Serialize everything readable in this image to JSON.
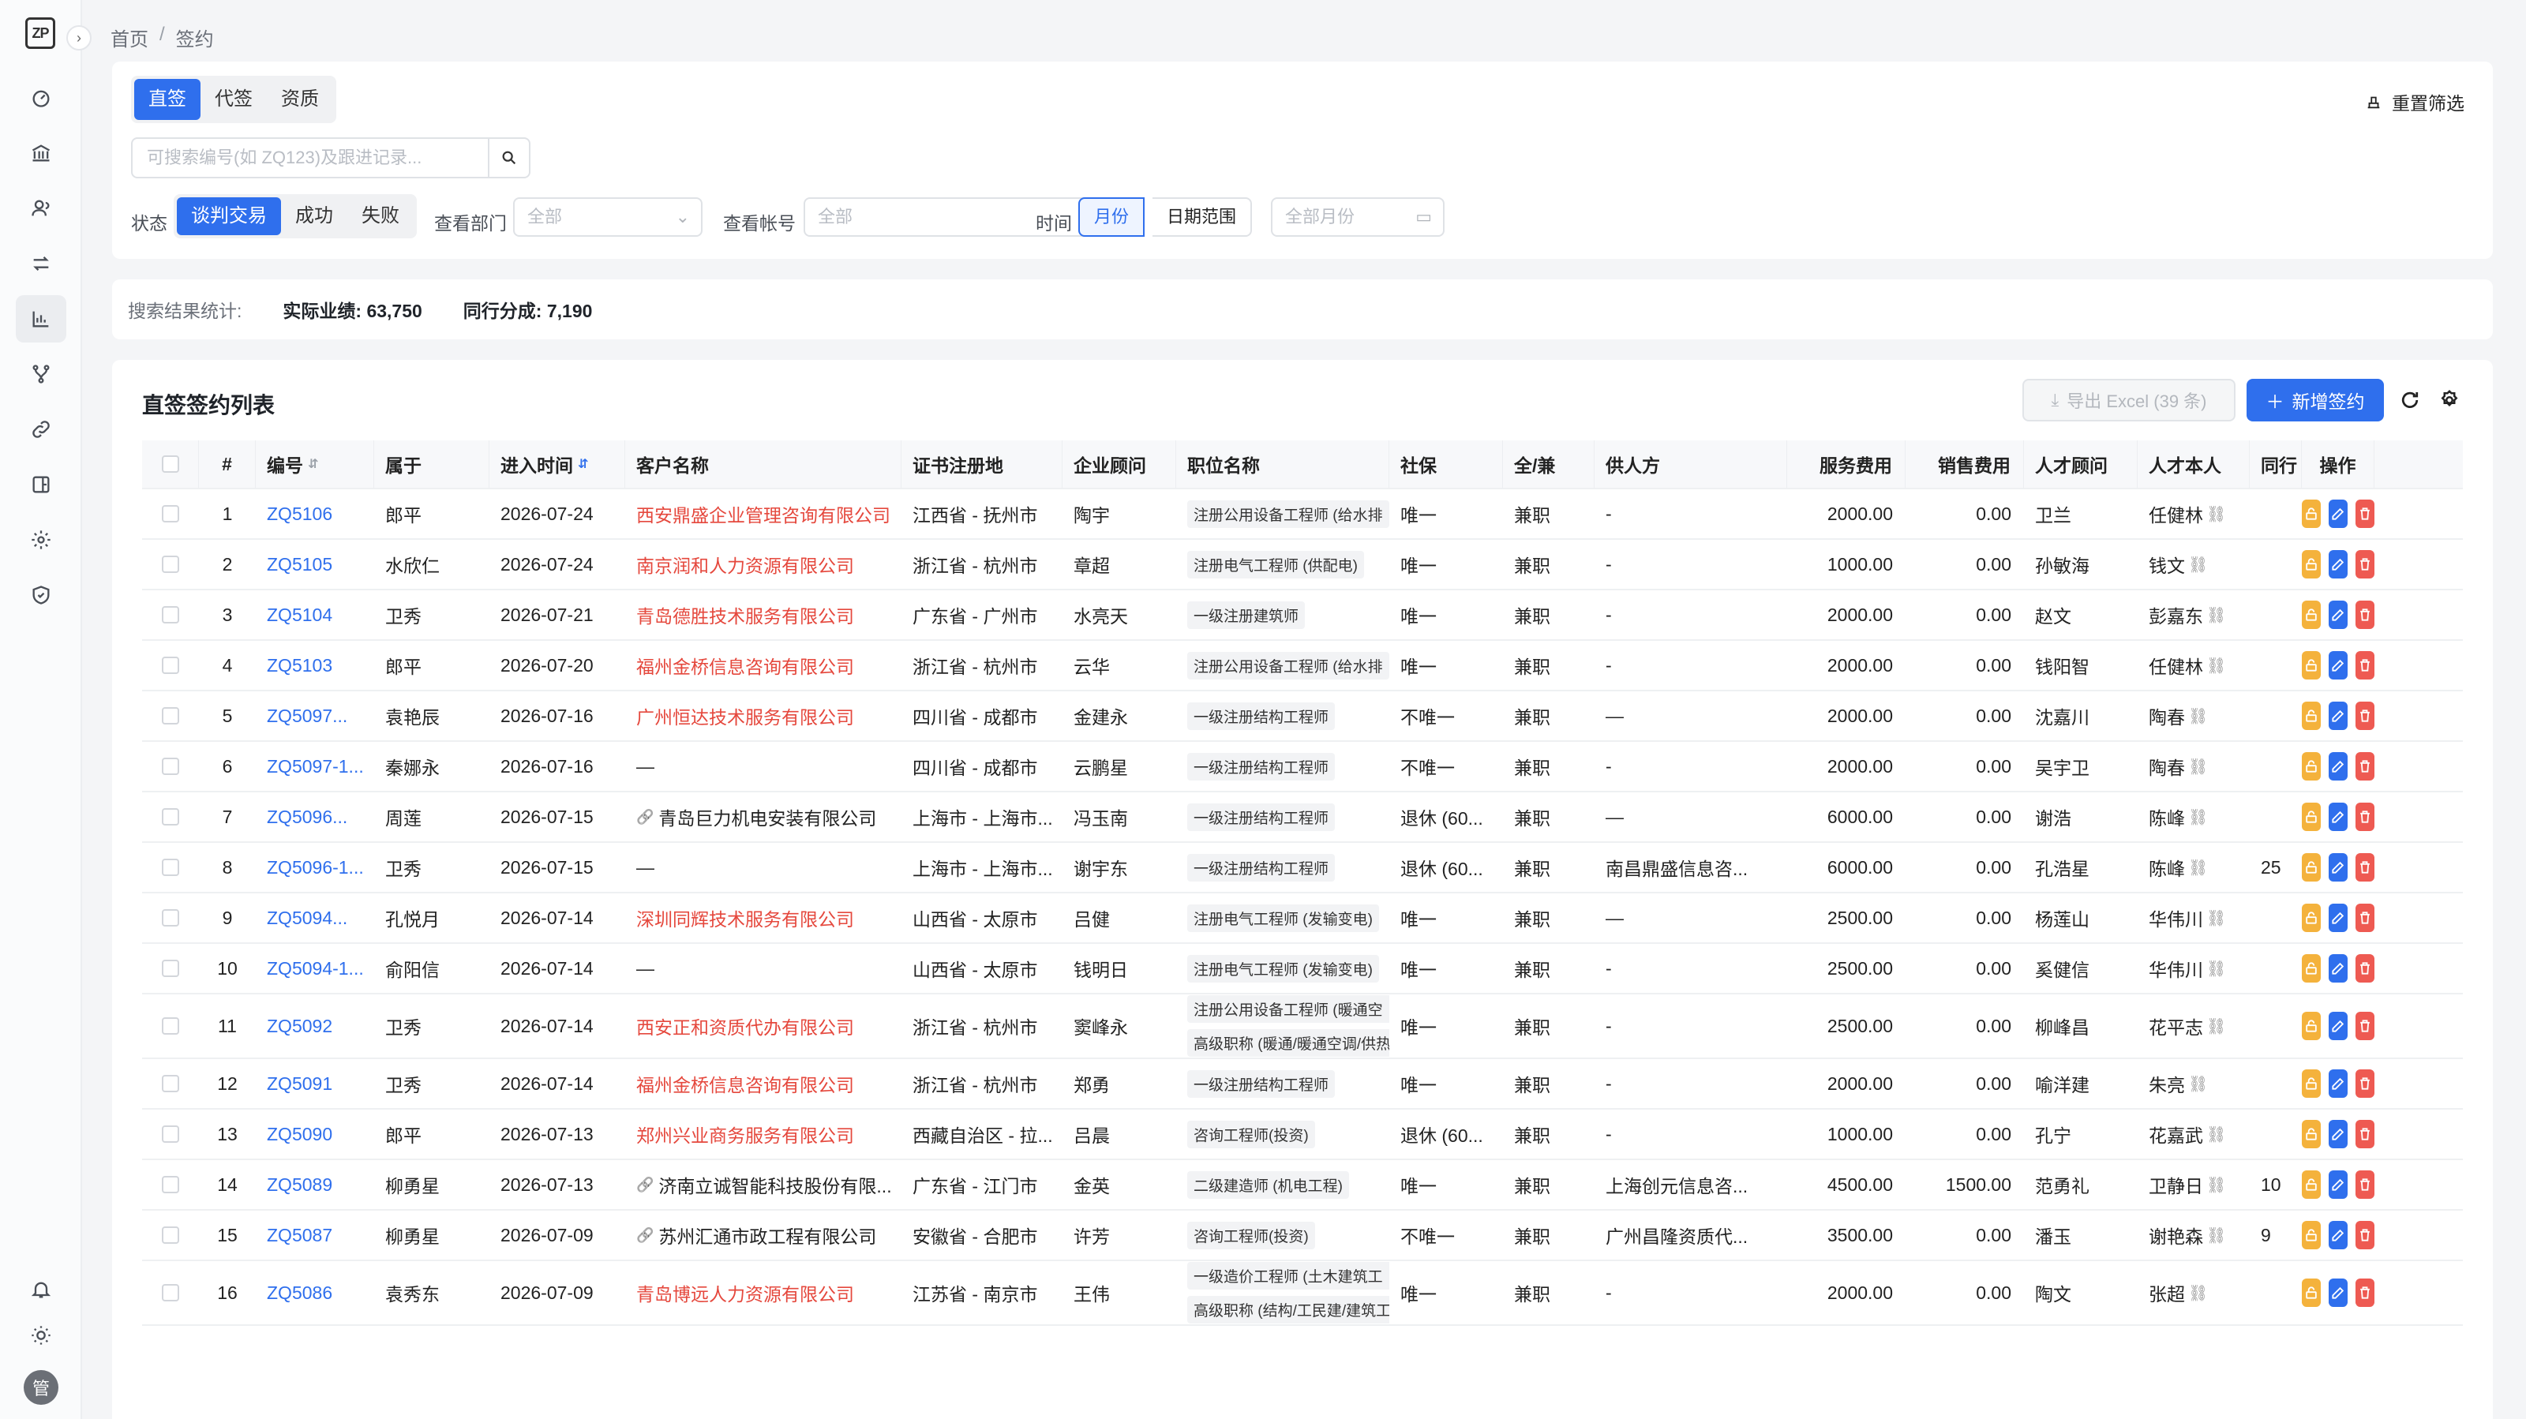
{
  "app": {
    "logo_text": "ZP"
  },
  "breadcrumb": {
    "home": "首页",
    "sep": "/",
    "current": "签约"
  },
  "tabs": [
    {
      "label": "直签",
      "active": true
    },
    {
      "label": "代签"
    },
    {
      "label": "资质"
    }
  ],
  "reset_label": "重置筛选",
  "search": {
    "placeholder": "可搜索编号(如 ZQ123)及跟进记录..."
  },
  "filters": {
    "status_label": "状态",
    "status_opts": [
      "谈判交易",
      "成功",
      "失败"
    ],
    "dept_label": "查看部门",
    "dept_value": "全部",
    "account_label": "查看帐号",
    "account_value": "全部",
    "time_label": "时间",
    "time_month": "月份",
    "time_range": "日期范围",
    "month_value": "全部月份"
  },
  "stats": {
    "label": "搜索结果统计:",
    "actual": "实际业绩: 63,750",
    "peer": "同行分成: 7,190"
  },
  "table": {
    "title": "直签签约列表",
    "export_label": "导出 Excel (39 条)",
    "add_label": "新增签约",
    "columns": [
      "#",
      "编号",
      "属于",
      "进入时间",
      "客户名称",
      "证书注册地",
      "企业顾问",
      "职位名称",
      "社保",
      "全/兼",
      "供人方",
      "服务费用",
      "销售费用",
      "人才顾问",
      "人才本人",
      "同行",
      "操作"
    ],
    "rows": [
      {
        "n": "1",
        "id": "ZQ5106",
        "owner": "郎平",
        "date": "2026-07-24",
        "client": "西安鼎盛企业管理咨询有限公司",
        "client_style": "red",
        "reg": "江西省 - 抚州市",
        "adv": "陶宇",
        "pos": [
          "注册公用设备工程师 (给水排"
        ],
        "ss": "唯一",
        "type": "兼职",
        "supplier": "-",
        "fee": "2000.00",
        "sales": "0.00",
        "tadv": "卫兰",
        "talent": "任健林",
        "peer": ""
      },
      {
        "n": "2",
        "id": "ZQ5105",
        "owner": "水欣仁",
        "date": "2026-07-24",
        "client": "南京润和人力资源有限公司",
        "client_style": "red",
        "reg": "浙江省 - 杭州市",
        "adv": "章超",
        "pos": [
          "注册电气工程师 (供配电)"
        ],
        "ss": "唯一",
        "type": "兼职",
        "supplier": "-",
        "fee": "1000.00",
        "sales": "0.00",
        "tadv": "孙敏海",
        "talent": "钱文",
        "peer": ""
      },
      {
        "n": "3",
        "id": "ZQ5104",
        "owner": "卫秀",
        "date": "2026-07-21",
        "client": "青岛德胜技术服务有限公司",
        "client_style": "red",
        "reg": "广东省 - 广州市",
        "adv": "水亮天",
        "pos": [
          "一级注册建筑师"
        ],
        "ss": "唯一",
        "type": "兼职",
        "supplier": "-",
        "fee": "2000.00",
        "sales": "0.00",
        "tadv": "赵文",
        "talent": "彭嘉东",
        "peer": ""
      },
      {
        "n": "4",
        "id": "ZQ5103",
        "owner": "郎平",
        "date": "2026-07-20",
        "client": "福州金桥信息咨询有限公司",
        "client_style": "red",
        "reg": "浙江省 - 杭州市",
        "adv": "云华",
        "pos": [
          "注册公用设备工程师 (给水排"
        ],
        "ss": "唯一",
        "type": "兼职",
        "supplier": "-",
        "fee": "2000.00",
        "sales": "0.00",
        "tadv": "钱阳智",
        "talent": "任健林",
        "peer": ""
      },
      {
        "n": "5",
        "id": "ZQ5097...",
        "owner": "袁艳辰",
        "date": "2026-07-16",
        "client": "广州恒达技术服务有限公司",
        "client_style": "red",
        "reg": "四川省 - 成都市",
        "adv": "金建永",
        "pos": [
          "一级注册结构工程师"
        ],
        "ss": "不唯一",
        "type": "兼职",
        "supplier": "—",
        "fee": "2000.00",
        "sales": "0.00",
        "tadv": "沈嘉川",
        "talent": "陶春",
        "peer": ""
      },
      {
        "n": "6",
        "id": "ZQ5097-1...",
        "owner": "秦娜永",
        "date": "2026-07-16",
        "client": "—",
        "client_style": "plain",
        "reg": "四川省 - 成都市",
        "adv": "云鹏星",
        "pos": [
          "一级注册结构工程师"
        ],
        "ss": "不唯一",
        "type": "兼职",
        "supplier": "-",
        "fee": "2000.00",
        "sales": "0.00",
        "tadv": "吴宇卫",
        "talent": "陶春",
        "peer": ""
      },
      {
        "n": "7",
        "id": "ZQ5096...",
        "owner": "周莲",
        "date": "2026-07-15",
        "client": "青岛巨力机电安装有限公司",
        "client_style": "chain",
        "reg": "上海市 - 上海市...",
        "adv": "冯玉南",
        "pos": [
          "一级注册结构工程师"
        ],
        "ss": "退休 (60...",
        "type": "兼职",
        "supplier": "—",
        "fee": "6000.00",
        "sales": "0.00",
        "tadv": "谢浩",
        "talent": "陈峰",
        "peer": ""
      },
      {
        "n": "8",
        "id": "ZQ5096-1...",
        "owner": "卫秀",
        "date": "2026-07-15",
        "client": "—",
        "client_style": "plain",
        "reg": "上海市 - 上海市...",
        "adv": "谢宇东",
        "pos": [
          "一级注册结构工程师"
        ],
        "ss": "退休 (60...",
        "type": "兼职",
        "supplier": "南昌鼎盛信息咨...",
        "fee": "6000.00",
        "sales": "0.00",
        "tadv": "孔浩星",
        "talent": "陈峰",
        "peer": "25"
      },
      {
        "n": "9",
        "id": "ZQ5094...",
        "owner": "孔悦月",
        "date": "2026-07-14",
        "client": "深圳同辉技术服务有限公司",
        "client_style": "red",
        "reg": "山西省 - 太原市",
        "adv": "吕健",
        "pos": [
          "注册电气工程师 (发输变电)"
        ],
        "ss": "唯一",
        "type": "兼职",
        "supplier": "—",
        "fee": "2500.00",
        "sales": "0.00",
        "tadv": "杨莲山",
        "talent": "华伟川",
        "peer": ""
      },
      {
        "n": "10",
        "id": "ZQ5094-1...",
        "owner": "俞阳信",
        "date": "2026-07-14",
        "client": "—",
        "client_style": "plain",
        "reg": "山西省 - 太原市",
        "adv": "钱明日",
        "pos": [
          "注册电气工程师 (发输变电)"
        ],
        "ss": "唯一",
        "type": "兼职",
        "supplier": "-",
        "fee": "2500.00",
        "sales": "0.00",
        "tadv": "奚健信",
        "talent": "华伟川",
        "peer": ""
      },
      {
        "n": "11",
        "id": "ZQ5092",
        "owner": "卫秀",
        "date": "2026-07-14",
        "client": "西安正和资质代办有限公司",
        "client_style": "red",
        "reg": "浙江省 - 杭州市",
        "adv": "窦峰永",
        "pos": [
          "注册公用设备工程师 (暖通空",
          "高级职称 (暖通/暖通空调/供热"
        ],
        "ss": "唯一",
        "type": "兼职",
        "supplier": "-",
        "fee": "2500.00",
        "sales": "0.00",
        "tadv": "柳峰昌",
        "talent": "花平志",
        "peer": ""
      },
      {
        "n": "12",
        "id": "ZQ5091",
        "owner": "卫秀",
        "date": "2026-07-14",
        "client": "福州金桥信息咨询有限公司",
        "client_style": "red",
        "reg": "浙江省 - 杭州市",
        "adv": "郑勇",
        "pos": [
          "一级注册结构工程师"
        ],
        "ss": "唯一",
        "type": "兼职",
        "supplier": "-",
        "fee": "2000.00",
        "sales": "0.00",
        "tadv": "喻洋建",
        "talent": "朱亮",
        "peer": ""
      },
      {
        "n": "13",
        "id": "ZQ5090",
        "owner": "郎平",
        "date": "2026-07-13",
        "client": "郑州兴业商务服务有限公司",
        "client_style": "red",
        "reg": "西藏自治区 - 拉...",
        "adv": "吕晨",
        "pos": [
          "咨询工程师(投资)"
        ],
        "ss": "退休 (60...",
        "type": "兼职",
        "supplier": "-",
        "fee": "1000.00",
        "sales": "0.00",
        "tadv": "孔宁",
        "talent": "花嘉武",
        "peer": ""
      },
      {
        "n": "14",
        "id": "ZQ5089",
        "owner": "柳勇星",
        "date": "2026-07-13",
        "client": "济南立诚智能科技股份有限...",
        "client_style": "chain",
        "reg": "广东省 - 江门市",
        "adv": "金英",
        "pos": [
          "二级建造师 (机电工程)"
        ],
        "ss": "唯一",
        "type": "兼职",
        "supplier": "上海创元信息咨...",
        "fee": "4500.00",
        "sales": "1500.00",
        "tadv": "范勇礼",
        "talent": "卫静日",
        "peer": "10"
      },
      {
        "n": "15",
        "id": "ZQ5087",
        "owner": "柳勇星",
        "date": "2026-07-09",
        "client": "苏州汇通市政工程有限公司",
        "client_style": "chain",
        "reg": "安徽省 - 合肥市",
        "adv": "许芳",
        "pos": [
          "咨询工程师(投资)"
        ],
        "ss": "不唯一",
        "type": "兼职",
        "supplier": "广州昌隆资质代...",
        "fee": "3500.00",
        "sales": "0.00",
        "tadv": "潘玉",
        "talent": "谢艳森",
        "peer": "9"
      },
      {
        "n": "16",
        "id": "ZQ5086",
        "owner": "袁秀东",
        "date": "2026-07-09",
        "client": "青岛博远人力资源有限公司",
        "client_style": "red",
        "reg": "江苏省 - 南京市",
        "adv": "王伟",
        "pos": [
          "一级造价工程师 (土木建筑工",
          "高级职称 (结构/工民建/建筑工"
        ],
        "ss": "唯一",
        "type": "兼职",
        "supplier": "-",
        "fee": "2000.00",
        "sales": "0.00",
        "tadv": "陶文",
        "talent": "张超",
        "peer": ""
      }
    ]
  }
}
